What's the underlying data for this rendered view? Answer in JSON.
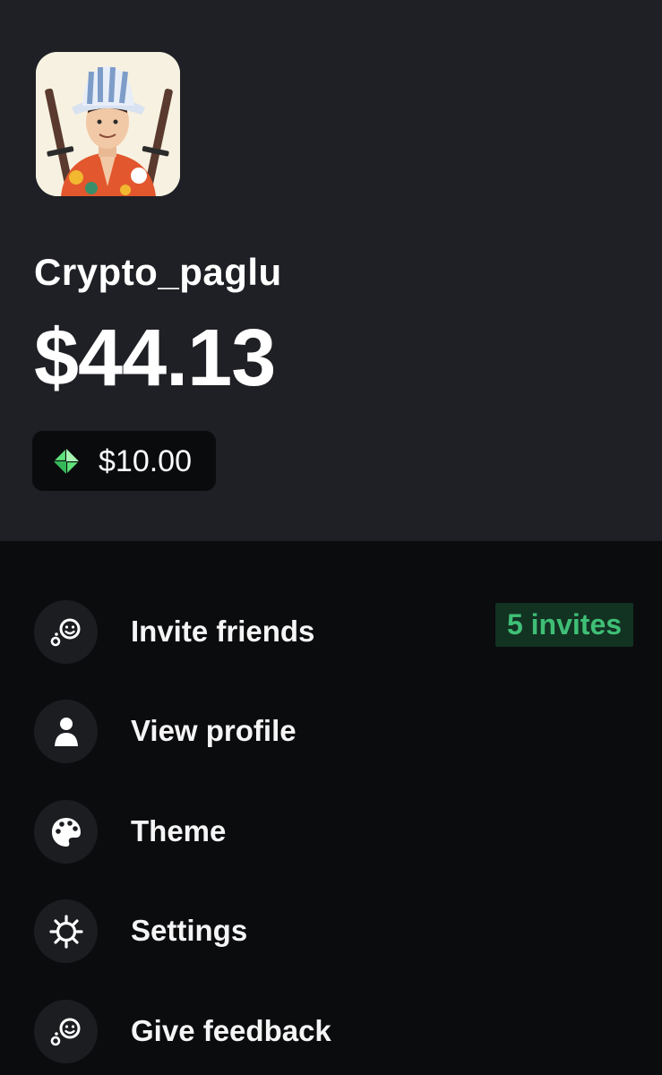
{
  "profile": {
    "username": "Crypto_paglu",
    "balance": "$44.13",
    "bonus_amount": "$10.00",
    "bonus_icon": "green-gem-icon"
  },
  "menu": {
    "items": [
      {
        "label": "Invite friends",
        "icon": "invite-friends-icon",
        "badge": "5 invites"
      },
      {
        "label": "View profile",
        "icon": "person-icon"
      },
      {
        "label": "Theme",
        "icon": "palette-icon"
      },
      {
        "label": "Settings",
        "icon": "gear-icon"
      },
      {
        "label": "Give feedback",
        "icon": "feedback-icon"
      }
    ]
  },
  "colors": {
    "header_bg": "#1f2025",
    "page_bg": "#0b0c0e",
    "accent_green": "#3fbf76",
    "badge_bg": "#123222"
  }
}
